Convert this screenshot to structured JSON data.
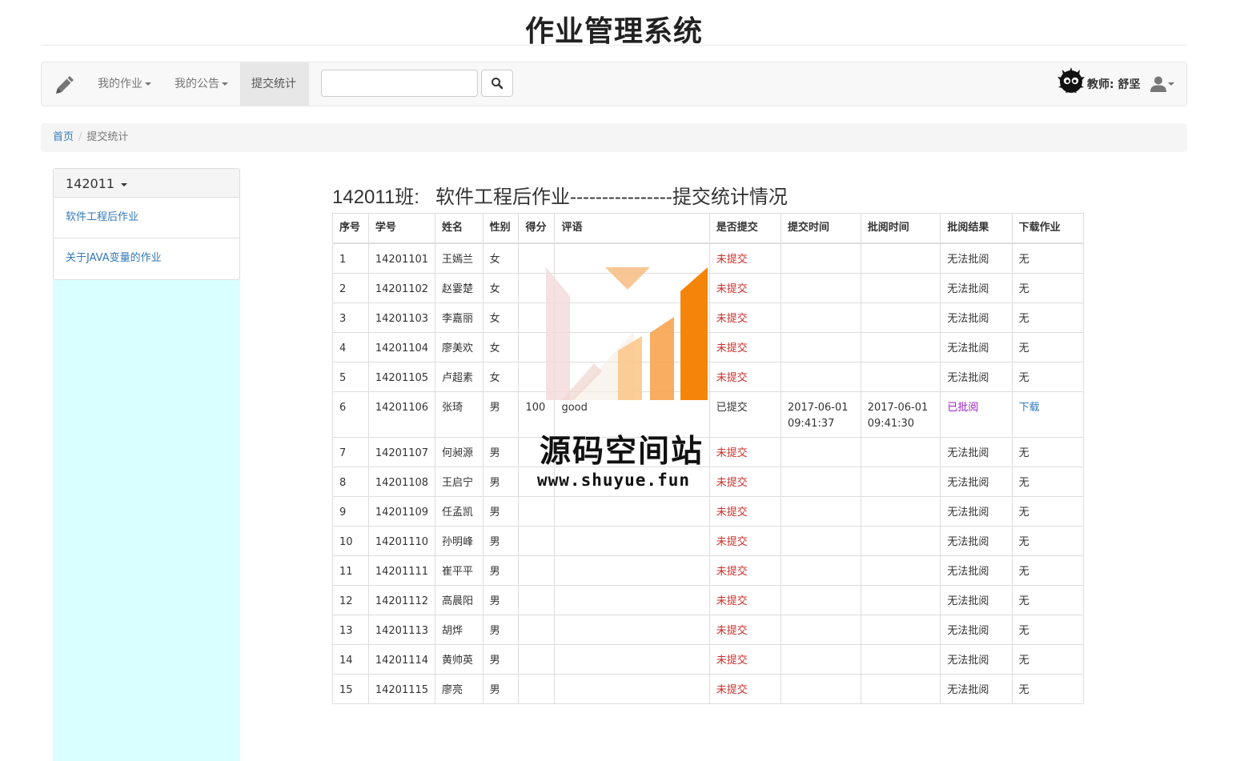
{
  "site_title": "作业管理系统",
  "navbar": {
    "brand_icon": "pencil-icon",
    "menu_homework": "我的作业",
    "menu_notice": "我的公告",
    "menu_stats": "提交统计",
    "search_placeholder": "",
    "search_icon": "search-icon",
    "teacher_label": "教师: 舒坚",
    "avatar_icon": "soot-sprite-avatar",
    "user_icon": "user-icon"
  },
  "breadcrumb": {
    "home": "首页",
    "separator": "/",
    "current": "提交统计"
  },
  "sidebar": {
    "class_selected": "142011",
    "items": [
      "软件工程后作业",
      "关于JAVA变量的作业"
    ]
  },
  "main": {
    "heading": "142011班:   软件工程后作业----------------提交统计情况",
    "columns": [
      "序号",
      "学号",
      "姓名",
      "性别",
      "得分",
      "评语",
      "是否提交",
      "提交时间",
      "批阅时间",
      "批阅结果",
      "下载作业"
    ],
    "rows": [
      {
        "no": "1",
        "id": "14201101",
        "name": "王嫣兰",
        "gender": "女",
        "score": "",
        "comment": "",
        "submitted": "未提交",
        "submit_time": "",
        "review_time": "",
        "result": "无法批阅",
        "download": "无"
      },
      {
        "no": "2",
        "id": "14201102",
        "name": "赵霎楚",
        "gender": "女",
        "score": "",
        "comment": "",
        "submitted": "未提交",
        "submit_time": "",
        "review_time": "",
        "result": "无法批阅",
        "download": "无"
      },
      {
        "no": "3",
        "id": "14201103",
        "name": "李嘉丽",
        "gender": "女",
        "score": "",
        "comment": "",
        "submitted": "未提交",
        "submit_time": "",
        "review_time": "",
        "result": "无法批阅",
        "download": "无"
      },
      {
        "no": "4",
        "id": "14201104",
        "name": "廖美欢",
        "gender": "女",
        "score": "",
        "comment": "",
        "submitted": "未提交",
        "submit_time": "",
        "review_time": "",
        "result": "无法批阅",
        "download": "无"
      },
      {
        "no": "5",
        "id": "14201105",
        "name": "卢超素",
        "gender": "女",
        "score": "",
        "comment": "",
        "submitted": "未提交",
        "submit_time": "",
        "review_time": "",
        "result": "无法批阅",
        "download": "无"
      },
      {
        "no": "6",
        "id": "14201106",
        "name": "张琦",
        "gender": "男",
        "score": "100",
        "comment": "good",
        "submitted": "已提交",
        "submit_time": "2017-06-01 09:41:37",
        "review_time": "2017-06-01 09:41:30",
        "result": "已批阅",
        "download": "下载"
      },
      {
        "no": "7",
        "id": "14201107",
        "name": "何昶源",
        "gender": "男",
        "score": "",
        "comment": "",
        "submitted": "未提交",
        "submit_time": "",
        "review_time": "",
        "result": "无法批阅",
        "download": "无"
      },
      {
        "no": "8",
        "id": "14201108",
        "name": "王启宁",
        "gender": "男",
        "score": "",
        "comment": "",
        "submitted": "未提交",
        "submit_time": "",
        "review_time": "",
        "result": "无法批阅",
        "download": "无"
      },
      {
        "no": "9",
        "id": "14201109",
        "name": "任孟凯",
        "gender": "男",
        "score": "",
        "comment": "",
        "submitted": "未提交",
        "submit_time": "",
        "review_time": "",
        "result": "无法批阅",
        "download": "无"
      },
      {
        "no": "10",
        "id": "14201110",
        "name": "孙明峰",
        "gender": "男",
        "score": "",
        "comment": "",
        "submitted": "未提交",
        "submit_time": "",
        "review_time": "",
        "result": "无法批阅",
        "download": "无"
      },
      {
        "no": "11",
        "id": "14201111",
        "name": "崔平平",
        "gender": "男",
        "score": "",
        "comment": "",
        "submitted": "未提交",
        "submit_time": "",
        "review_time": "",
        "result": "无法批阅",
        "download": "无"
      },
      {
        "no": "12",
        "id": "14201112",
        "name": "高晨阳",
        "gender": "男",
        "score": "",
        "comment": "",
        "submitted": "未提交",
        "submit_time": "",
        "review_time": "",
        "result": "无法批阅",
        "download": "无"
      },
      {
        "no": "13",
        "id": "14201113",
        "name": "胡烨",
        "gender": "男",
        "score": "",
        "comment": "",
        "submitted": "未提交",
        "submit_time": "",
        "review_time": "",
        "result": "无法批阅",
        "download": "无"
      },
      {
        "no": "14",
        "id": "14201114",
        "name": "黄帅英",
        "gender": "男",
        "score": "",
        "comment": "",
        "submitted": "未提交",
        "submit_time": "",
        "review_time": "",
        "result": "无法批阅",
        "download": "无"
      },
      {
        "no": "15",
        "id": "14201115",
        "name": "廖亮",
        "gender": "男",
        "score": "",
        "comment": "",
        "submitted": "未提交",
        "submit_time": "",
        "review_time": "",
        "result": "无法批阅",
        "download": "无"
      }
    ]
  },
  "watermark": {
    "name": "源码空间站",
    "url": "www.shuyue.fun"
  },
  "colors": {
    "link": "#337ab7",
    "not_submitted": "#c9302c",
    "reviewed": "#a020c8",
    "sidebar_fill": "#d9fffe",
    "watermark_orange": "#f5850a"
  }
}
